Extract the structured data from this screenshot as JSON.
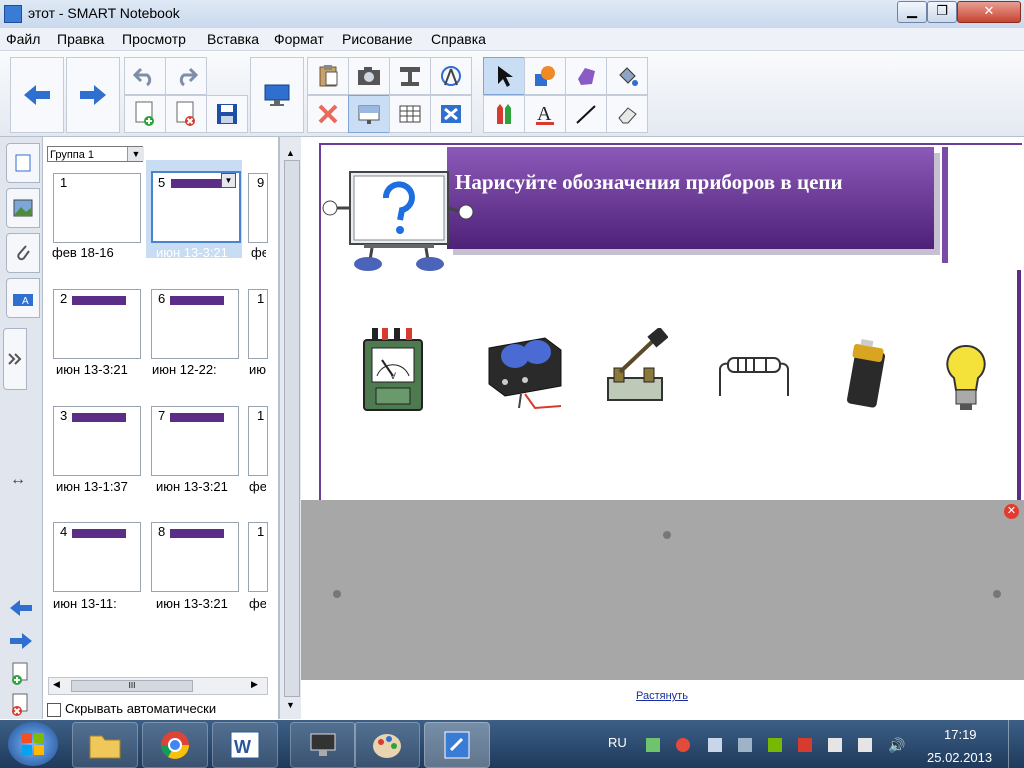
{
  "window": {
    "title": "этот - SMART Notebook",
    "min": "▁",
    "max": "❐",
    "close": "✕"
  },
  "menu": [
    "Файл",
    "Правка",
    "Просмотр",
    "Вставка",
    "Формат",
    "Рисование",
    "Справка"
  ],
  "sorter": {
    "group": "Группа 1",
    "thumbs": [
      {
        "num": "1",
        "cap": "фев 18-16"
      },
      {
        "num": "5",
        "cap": "июн 13-3:21"
      },
      {
        "num": "9",
        "cap": "фе"
      },
      {
        "num": "2",
        "cap": "июн 13-3:21"
      },
      {
        "num": "6",
        "cap": "июн 12-22:"
      },
      {
        "num": "1",
        "cap": "июн"
      },
      {
        "num": "3",
        "cap": "июн 13-1:37"
      },
      {
        "num": "7",
        "cap": "июн 13-3:21"
      },
      {
        "num": "1",
        "cap": "фе"
      },
      {
        "num": "4",
        "cap": "июн 13-11:"
      },
      {
        "num": "8",
        "cap": "июн 13-3:21"
      },
      {
        "num": "1",
        "cap": "фе"
      }
    ],
    "hide_auto": "Скрывать автоматически",
    "scroll_mark": "III"
  },
  "page": {
    "heading": "Нарисуйте обозначения приборов в цепи"
  },
  "shade": {
    "stretch": "Растянуть"
  },
  "taskbar": {
    "lang": "RU",
    "time": "17:19",
    "date": "25.02.2013"
  },
  "colors": {
    "accent": "#5b2d86",
    "toolbar_blue": "#2f6fd0",
    "shade": "#a7a7a7"
  }
}
